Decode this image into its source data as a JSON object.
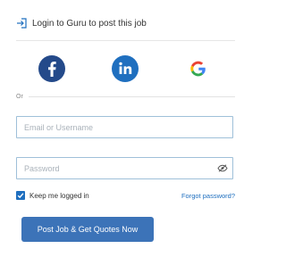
{
  "header": {
    "icon": "login-icon",
    "title": "Login to Guru to post this job"
  },
  "social": [
    {
      "icon": "facebook-icon",
      "color": "#244a8a"
    },
    {
      "icon": "linkedin-icon",
      "color": "#1f6fbf"
    },
    {
      "icon": "google-icon"
    }
  ],
  "divider": {
    "label": "Or"
  },
  "form": {
    "email_placeholder": "Email or Username",
    "password_placeholder": "Password",
    "password_toggle_icon": "eye-slash-icon",
    "remember_label": "Keep me logged in",
    "remember_checked": true,
    "forgot_label": "Forgot password?",
    "submit_label": "Post Job & Get Quotes Now"
  },
  "colors": {
    "accent": "#1f6fbf",
    "button": "#3c73b8",
    "input_border": "#9fc0d9"
  }
}
